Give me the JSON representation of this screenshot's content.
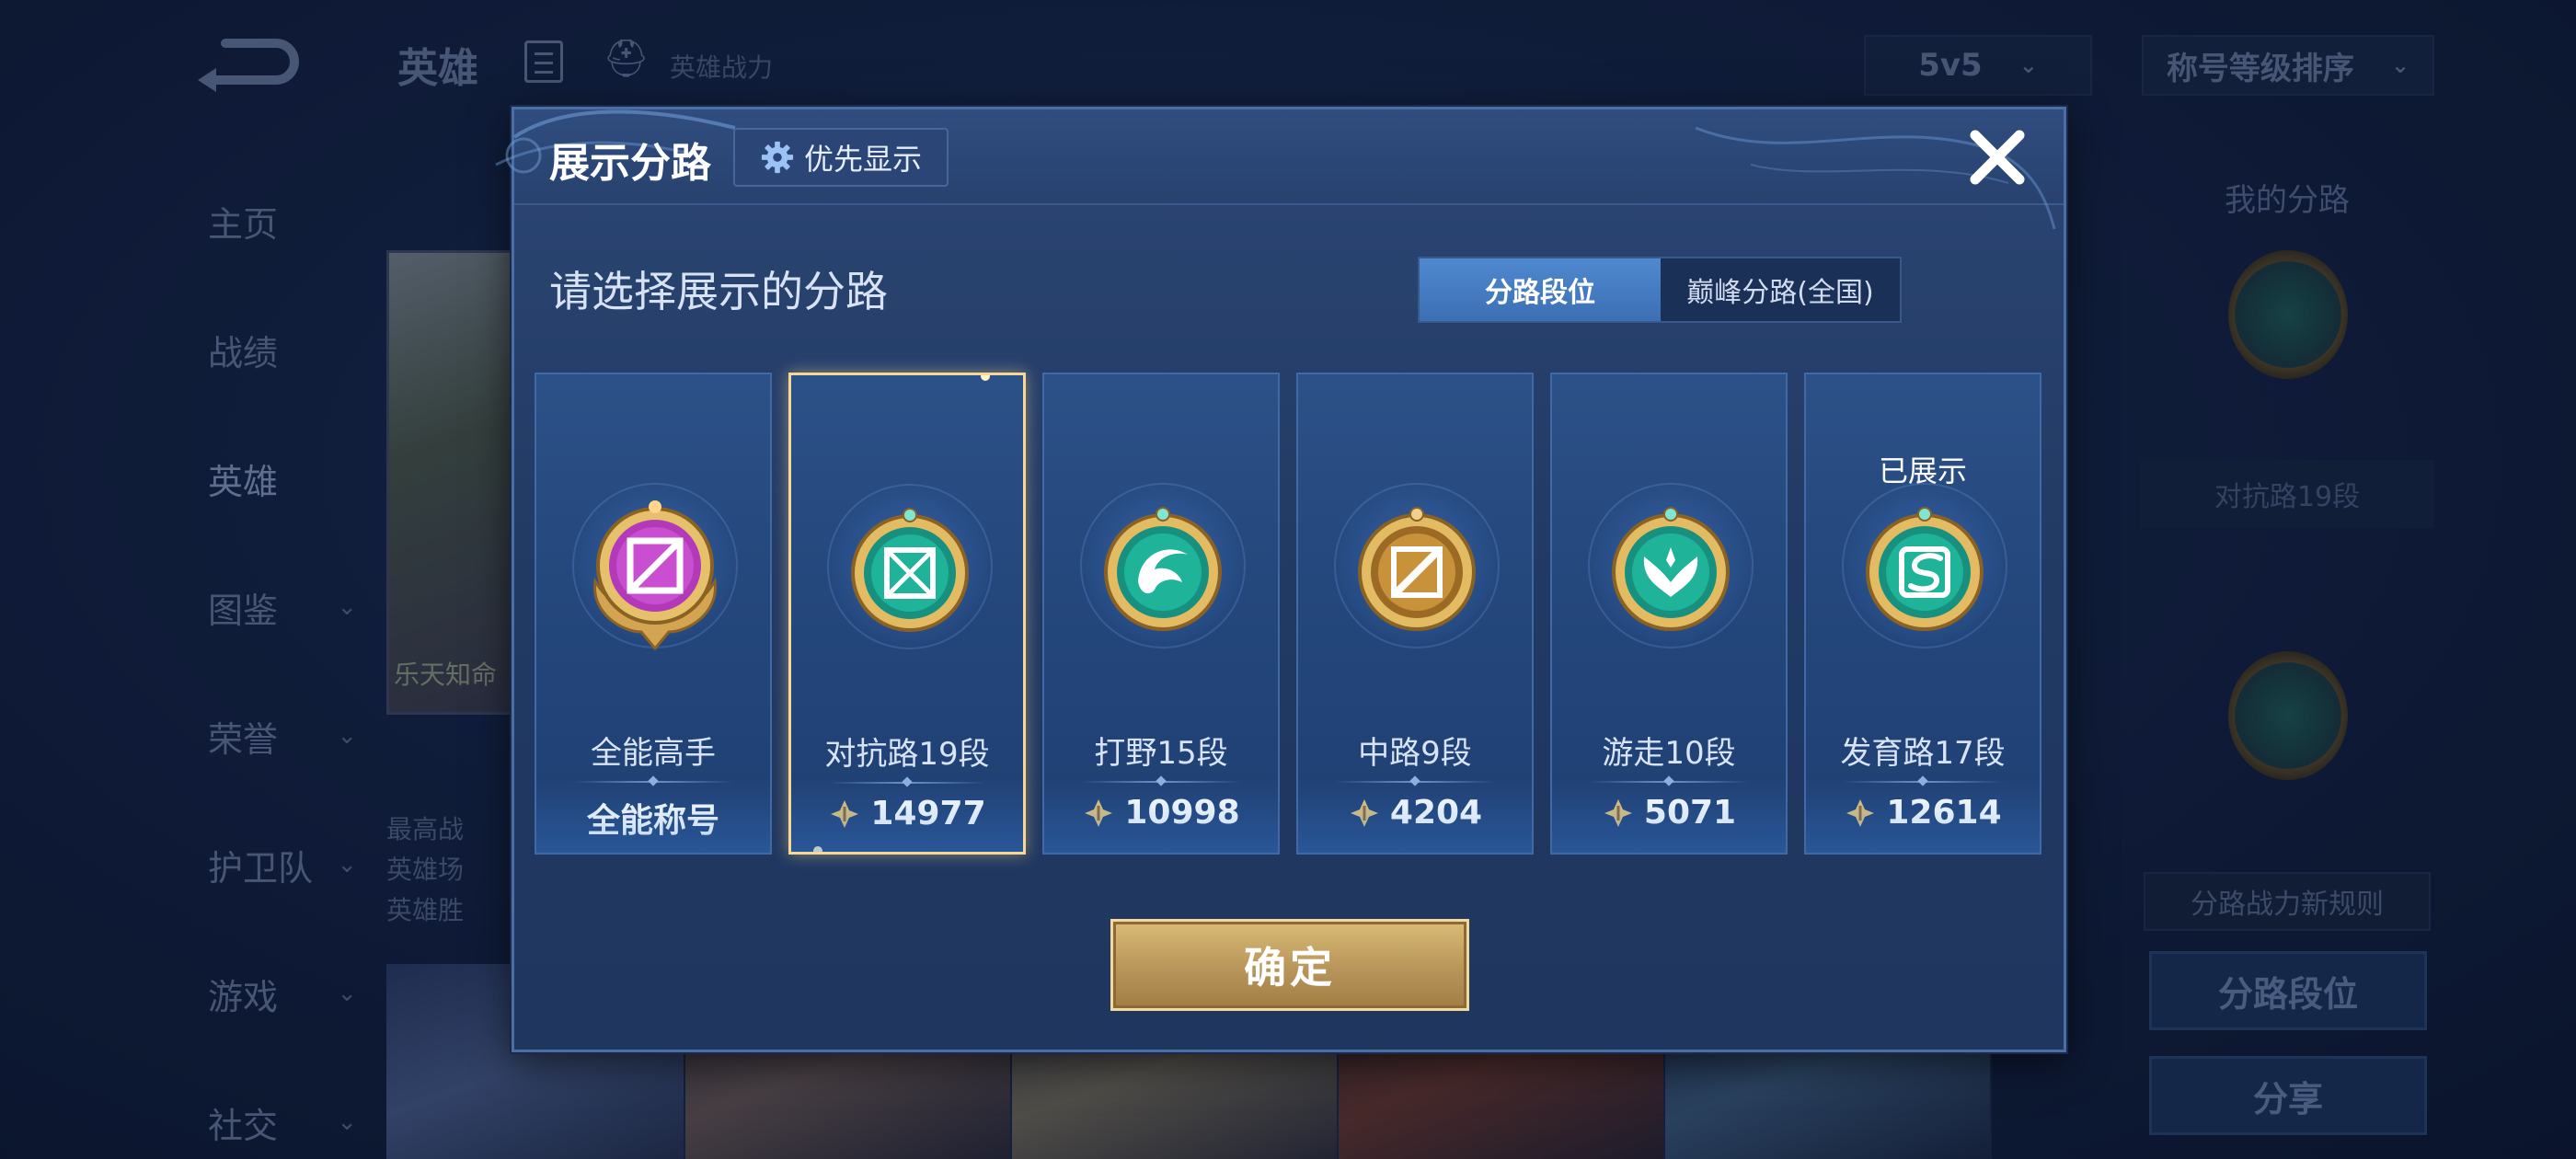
{
  "background": {
    "top_title": "英雄",
    "power_label": "英雄战力",
    "mode_select": "5v5",
    "sort_select": "称号等级排序",
    "nav": [
      {
        "label": "主页",
        "has_chevron": false
      },
      {
        "label": "战绩",
        "has_chevron": false
      },
      {
        "label": "英雄",
        "has_chevron": false
      },
      {
        "label": "图鉴",
        "has_chevron": true
      },
      {
        "label": "荣誉",
        "has_chevron": true
      },
      {
        "label": "护卫队",
        "has_chevron": true
      },
      {
        "label": "游戏",
        "has_chevron": true
      },
      {
        "label": "社交",
        "has_chevron": true
      }
    ],
    "hero_caption": "乐天知命",
    "hero_stats": [
      "最高战",
      "英雄场",
      "英雄胜"
    ],
    "right_panel": {
      "title": "我的分路",
      "rank_text": "对抗路19段",
      "rule_text": "分路战力新规则",
      "lane_rank_button": "分路段位",
      "share_button": "分享"
    }
  },
  "modal": {
    "title": "展示分路",
    "priority_button": "优先显示",
    "prompt": "请选择展示的分路",
    "tabs": [
      "分路段位",
      "巅峰分路(全国)"
    ],
    "active_tab": 0,
    "cards": [
      {
        "lane": "全能高手",
        "value": "全能称号",
        "show_power_icon": false,
        "selected": false,
        "shown_label": "",
        "badge_color": "#c23fc9"
      },
      {
        "lane": "对抗路19段",
        "value": "14977",
        "show_power_icon": true,
        "selected": true,
        "shown_label": "",
        "badge_color": "#1fb39a"
      },
      {
        "lane": "打野15段",
        "value": "10998",
        "show_power_icon": true,
        "selected": false,
        "shown_label": "",
        "badge_color": "#1fb39a"
      },
      {
        "lane": "中路9段",
        "value": "4204",
        "show_power_icon": true,
        "selected": false,
        "shown_label": "",
        "badge_color": "#c8923a"
      },
      {
        "lane": "游走10段",
        "value": "5071",
        "show_power_icon": true,
        "selected": false,
        "shown_label": "",
        "badge_color": "#1fb39a"
      },
      {
        "lane": "发育路17段",
        "value": "12614",
        "show_power_icon": true,
        "selected": false,
        "shown_label": "已展示",
        "badge_color": "#1fb39a"
      }
    ],
    "confirm_button": "确定"
  },
  "colors": {
    "gold": "#d9bc76",
    "accent_blue": "#4f89cf",
    "selected_border": "#f6d894"
  }
}
